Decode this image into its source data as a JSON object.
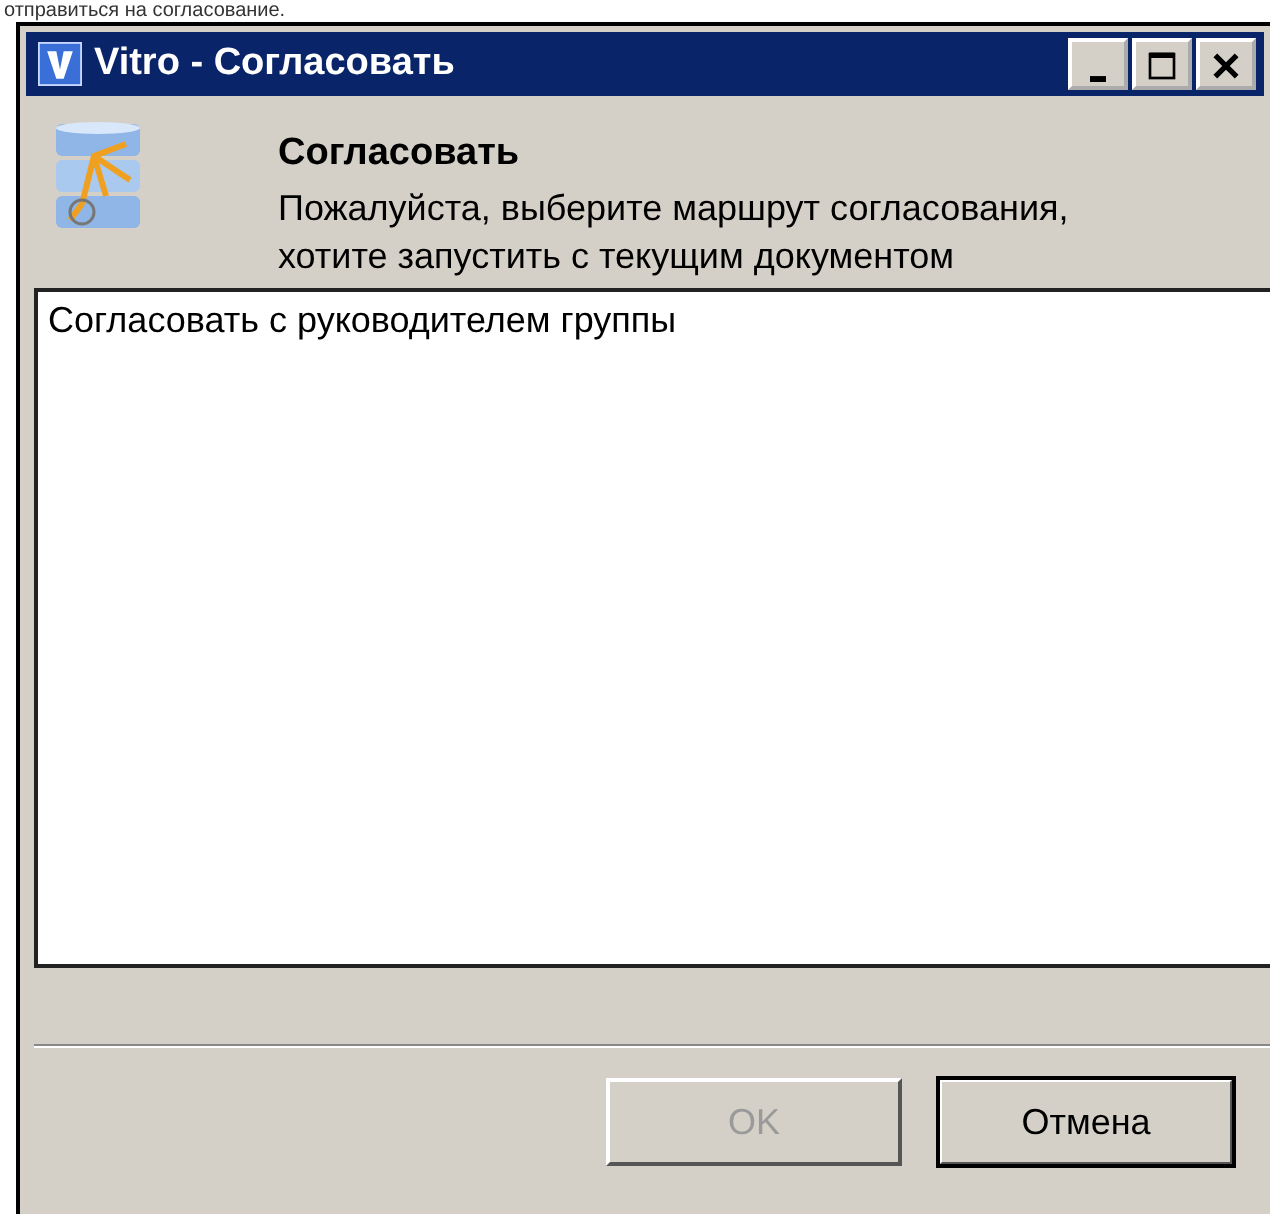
{
  "caption": "отправиться на согласование.",
  "window": {
    "title": "Vitro - Согласовать"
  },
  "header": {
    "title": "Согласовать",
    "description": [
      "Пожалуйста, выберите маршрут согласования,",
      "хотите запустить с текущим документом"
    ]
  },
  "routes": [
    {
      "label": "Согласовать с руководителем группы"
    }
  ],
  "buttons": [
    {
      "label": "OK",
      "disabled": true,
      "default": false
    },
    {
      "label": "Отмена",
      "disabled": false,
      "default": true
    }
  ]
}
